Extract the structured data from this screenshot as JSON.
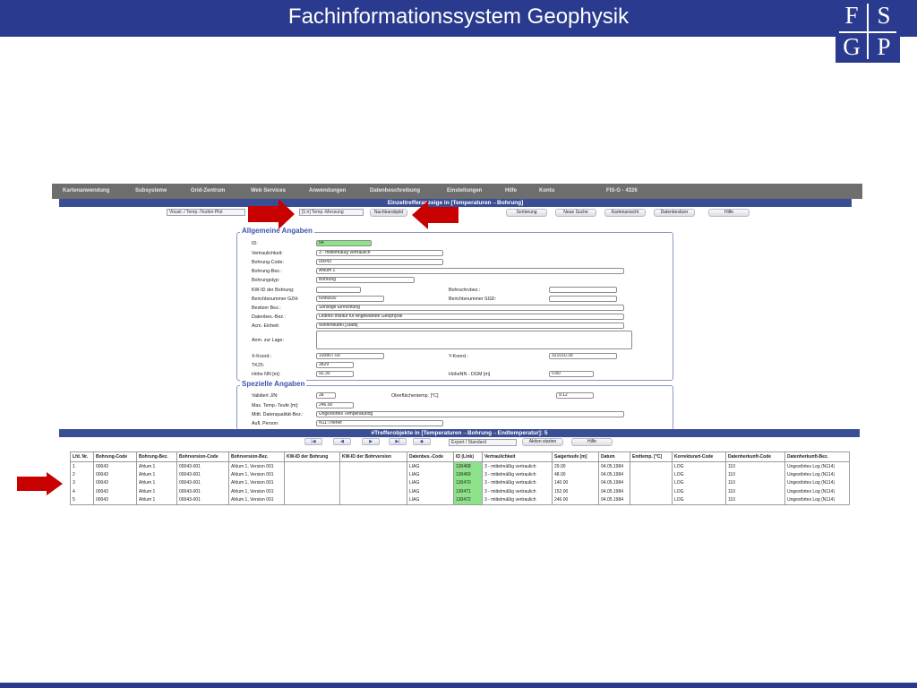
{
  "slide": {
    "title": "Fachinformationssystem Geophysik",
    "logo": {
      "letters": [
        "F",
        "S",
        "G",
        "P"
      ]
    }
  },
  "colors": {
    "brand": "#2a3a8e",
    "accent_bar": "#3a4e96",
    "highlight": "#8de28a",
    "arrow": "#c80000"
  },
  "app": {
    "menu": [
      "Kartenanwendung",
      "Subsysteme",
      "Grid-Zentrum",
      "Web Services",
      "Anwendungen",
      "Datenbeschreibung",
      "Einstellungen",
      "Hilfe",
      "Kontu",
      "FIS-G - 4326"
    ],
    "detail_title": "Einzeltrefferanzeige in [Temperaturen→Bohrung]",
    "toolbar": {
      "visual_select": "Visuel. / Temp.-Teufen-Plot",
      "relation_select": "[1:n] Temp.-Messung",
      "buttons": [
        "Nachbarobjekt",
        "Sortierung",
        "Neue Suche",
        "Kartenansicht",
        "Datenbesitzer",
        "Hilfe"
      ]
    },
    "general": {
      "legend": "Allgemeine Angaben",
      "fields": {
        "id_label": "ID:",
        "id_value": "54",
        "vertr_label": "Vertraulichkeit:",
        "vertr_value": "3 - mittelmäßig vertraulich",
        "bcode_label": "Bohrung-Code:",
        "bcode_value": "00043",
        "bbez_label": "Bohrung-Bez.:",
        "bbez_value": "Ahlum 1",
        "btyp_label": "Bohrungstyp:",
        "btyp_value": "Bohrung",
        "kwid_label": "KW-ID der Bohrung:",
        "kwid_value": "",
        "berichtgzh_label": "Berichtsnummer GZH:",
        "berichtgzh_value": "6096830",
        "besitzer_label": "Besitzer Bez.:",
        "besitzer_value": "Sonstige Einrichtung",
        "datenbes_label": "Datenbes.-Bez.:",
        "datenbes_value": "Leibniz-Institut für Angewandte Geophysik",
        "verw_label": "Acm. Einheit:",
        "verw_value": "Wolfenbüttel [Stadt]",
        "anm_label": "Anm. zur Lage:",
        "anm_value": "",
        "x_label": "X-Koord.:",
        "x_value": "100807.00",
        "tk25_label": "TK25:",
        "tk25_value": "3829",
        "hoehe_label": "Höhe NN [m]:",
        "hoehe_value": "92.30",
        "bohrschr_label": "Bohrschrvbez.:",
        "bohrschr_value": "",
        "berichtsgd_label": "Berichtsnummer SGD:",
        "berichtsgd_value": "",
        "y_label": "Y-Koord.:",
        "y_value": "321010.39",
        "dgm_label": "HöheNN - DGM [m]",
        "dgm_value": "0.80"
      }
    },
    "special": {
      "legend": "Spezielle Angaben",
      "fields": {
        "valid_label": "Validiert J/N:",
        "valid_value": "Ja",
        "oberfl_label": "Oberflächentemp. [°C]",
        "oberfl_value": "9.12",
        "maxt_label": "Max. Temp.-Teufe [m]:",
        "maxt_value": "246.00",
        "mittl_label": "Mittl. Datenqualität-Bez.:",
        "mittl_value": "Ungestörtes Temperaturlog",
        "aufn_label": "Aufl. Person:",
        "aufn_value": "N11:Thener"
      }
    },
    "results": {
      "title": "#Trefferobjekte in [Temperaturen→Bohrung→Endtemperatur]: 5",
      "export_select": "Export / Standard",
      "action_button": "Aktion starten",
      "help_button": "Hilfe",
      "columns": [
        "Lfd. Nr.",
        "Bohrung-Code",
        "Bohrung-Bez.",
        "Bohrversion-Code",
        "Bohrversion-Bez.",
        "KW-ID der Bohrung",
        "KW-ID der Bohrversion",
        "Datenbes.-Code",
        "ID (Link)",
        "Vertraulichkeit",
        "Saigerteufe [m]",
        "Datum",
        "Endtemp. [°C]",
        "Korrekturart-Code",
        "Datenherkunft-Code",
        "Datenherkunft-Bez."
      ],
      "rows": [
        [
          "1",
          "00043",
          "Ahlum 1",
          "00043-001",
          "Ahlum 1, Version 001",
          "",
          "",
          "LIAG",
          "130468",
          "3 - mittelmäßig vertraulich",
          "29.00",
          "04.05.1984",
          "",
          "LOG",
          "110",
          "Ungestörtes Log (N114)"
        ],
        [
          "2",
          "00043",
          "Ahlum 1",
          "00043-001",
          "Ahlum 1, Version 001",
          "",
          "",
          "LIAG",
          "130469",
          "3 - mittelmäßig vertraulich",
          "48.00",
          "04.05.1984",
          "",
          "LOG",
          "110",
          "Ungestörtes Log (N114)"
        ],
        [
          "3",
          "00043",
          "Ahlum 1",
          "00043-001",
          "Ahlum 1, Version 001",
          "",
          "",
          "LIAG",
          "130470",
          "3 - mittelmäßig vertraulich",
          "140.00",
          "04.05.1984",
          "",
          "LOG",
          "110",
          "Ungestörtes Log (N114)"
        ],
        [
          "4",
          "00043",
          "Ahlum 1",
          "00043-001",
          "Ahlum 1, Version 001",
          "",
          "",
          "LIAG",
          "130471",
          "3 - mittelmäßig vertraulich",
          "152.00",
          "04.05.1984",
          "",
          "LOG",
          "110",
          "Ungestörtes Log (N114)"
        ],
        [
          "5",
          "00043",
          "Ahlum 1",
          "00043-001",
          "Ahlum 1, Version 001",
          "",
          "",
          "LIAG",
          "130472",
          "3 - mittelmäßig vertraulich",
          "246.00",
          "04.05.1984",
          "",
          "LOG",
          "110",
          "Ungestörtes Log (N114)"
        ]
      ]
    }
  }
}
